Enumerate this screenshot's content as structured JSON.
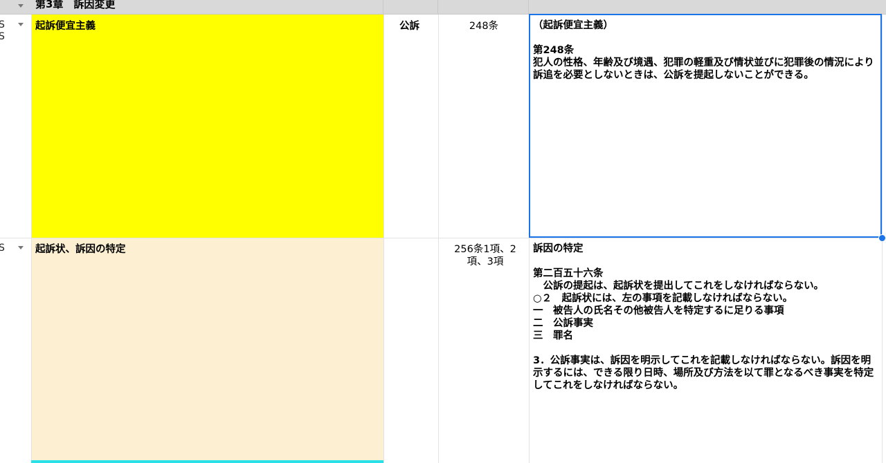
{
  "chapter_row": {
    "title": "第3章　訴因変更"
  },
  "rows": [
    {
      "row_marker": "S\nS",
      "topic": "起訴便宜主義",
      "category": "公訴",
      "article": "248条",
      "body": "（起訴便宜主義）\n\n第248条\n犯人の性格、年齢及び境遇、犯罪の軽重及び情状並びに犯罪後の情況により訴追を必要としないときは、公訴を提起しないことができる。",
      "highlight_color": "#ffff00"
    },
    {
      "row_marker": "S",
      "topic": "起訴状、訴因の特定",
      "category": "",
      "article": "256条1項、2項、3項",
      "body": "訴因の特定\n\n第二百五十六条\n　公訴の提起は、起訴状を提出してこれをしなければならない。\n○２　起訴状には、左の事項を記載しなければならない。\n一　被告人の氏名その他被告人を特定するに足りる事項\n二　公訴事実\n三　罪名\n\n3．公訴事実は、訴因を明示してこれを記載しなければならない。訴因を明示するには、できる限り日時、場所及び方法を以て罪となるべき事実を特定してこれをしなければならない。",
      "highlight_color": "#fdefd2"
    }
  ],
  "colors": {
    "selection": "#1a73e8",
    "header_bg": "#d9d9d9",
    "grid": "#e2e2e2",
    "bottom_bar": "#28e0e6"
  }
}
